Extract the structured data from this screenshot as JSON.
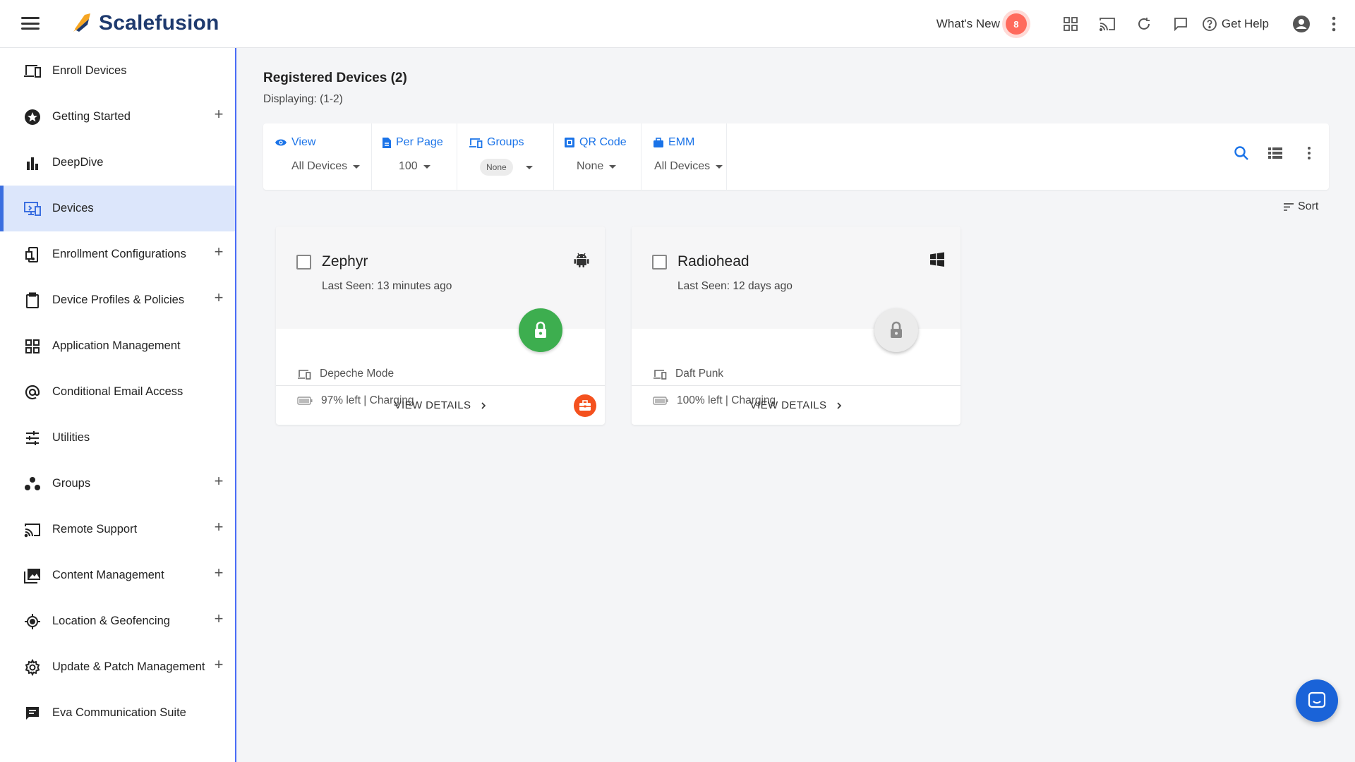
{
  "brand": {
    "name": "Scalefusion"
  },
  "topbar": {
    "whats_new_label": "What's New",
    "whats_new_count": "8",
    "get_help_label": "Get Help",
    "icons": [
      "apps-grid-icon",
      "cast-icon",
      "refresh-icon",
      "chat-icon",
      "help-icon",
      "account-icon",
      "more-vert-icon"
    ]
  },
  "sidebar": {
    "items": [
      {
        "label": "Enroll Devices",
        "icon": "enroll-devices-icon",
        "expandable": false
      },
      {
        "label": "Getting Started",
        "icon": "star-icon",
        "expandable": true
      },
      {
        "label": "DeepDive",
        "icon": "bar-chart-icon",
        "expandable": false
      },
      {
        "label": "Devices",
        "icon": "devices-icon",
        "expandable": false,
        "active": true
      },
      {
        "label": "Enrollment Configurations",
        "icon": "enrollment-config-icon",
        "expandable": true
      },
      {
        "label": "Device Profiles & Policies",
        "icon": "clipboard-icon",
        "expandable": true
      },
      {
        "label": "Application Management",
        "icon": "apps-icon",
        "expandable": false
      },
      {
        "label": "Conditional Email Access",
        "icon": "at-icon",
        "expandable": false
      },
      {
        "label": "Utilities",
        "icon": "sliders-icon",
        "expandable": false
      },
      {
        "label": "Groups",
        "icon": "groups-icon",
        "expandable": true
      },
      {
        "label": "Remote Support",
        "icon": "cast-icon",
        "expandable": true
      },
      {
        "label": "Content Management",
        "icon": "photo-library-icon",
        "expandable": true
      },
      {
        "label": "Location & Geofencing",
        "icon": "location-icon",
        "expandable": true
      },
      {
        "label": "Update & Patch Management",
        "icon": "gear-icon",
        "expandable": true
      },
      {
        "label": "Eva Communication Suite",
        "icon": "message-icon",
        "expandable": false
      }
    ],
    "plus_symbol": "+"
  },
  "main": {
    "title": "Registered Devices (2)",
    "displaying": "Displaying: (1-2)",
    "sort_label": "Sort"
  },
  "filters": {
    "view": {
      "label": "View",
      "value": "All Devices"
    },
    "per_page": {
      "label": "Per Page",
      "value": "100"
    },
    "groups": {
      "label": "Groups",
      "value": "None"
    },
    "qr_code": {
      "label": "QR Code",
      "value": "None"
    },
    "emm": {
      "label": "EMM",
      "value": "All Devices"
    }
  },
  "devices": [
    {
      "name": "Zephyr",
      "last_seen": "Last Seen: 13 minutes ago",
      "os": "android",
      "locked": true,
      "model": "Depeche Mode",
      "battery": "97% left | Charging",
      "action": "VIEW DETAILS",
      "work_profile": true
    },
    {
      "name": "Radiohead",
      "last_seen": "Last Seen: 12 days ago",
      "os": "windows",
      "locked": false,
      "model": "Daft Punk",
      "battery": "100% left | Charging",
      "action": "VIEW DETAILS",
      "work_profile": false
    }
  ],
  "colors": {
    "brand_navy": "#1e3a6e",
    "accent_blue": "#1a73e8",
    "active_nav_bg": "#dce6fb",
    "lock_green": "#3dae4f",
    "badge_red": "#ff6a5c",
    "work_orange": "#f4511e"
  }
}
